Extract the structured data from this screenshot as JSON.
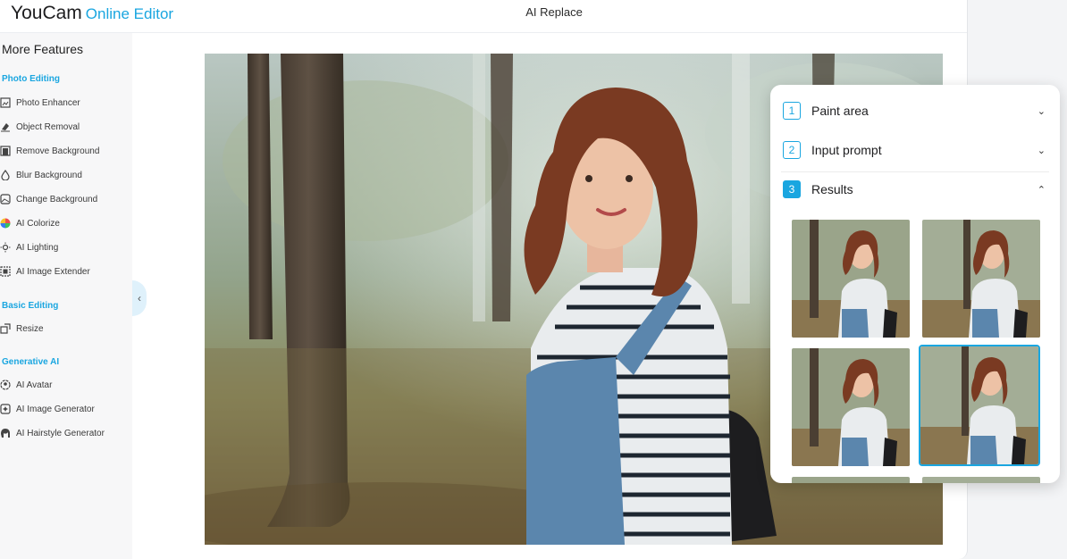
{
  "header": {
    "brand": "YouCam",
    "brand_tag": "Online Editor",
    "title": "AI Replace"
  },
  "sidebar": {
    "heading": "More Features",
    "sections": [
      {
        "title": "Photo Editing"
      },
      {
        "title": "Basic Editing"
      },
      {
        "title": "Generative AI"
      }
    ],
    "photo_editing": [
      {
        "label": "Photo Enhancer",
        "icon": "enhance-icon"
      },
      {
        "label": "Object Removal",
        "icon": "eraser-icon"
      },
      {
        "label": "Remove Background",
        "icon": "remove-bg-icon"
      },
      {
        "label": "Blur Background",
        "icon": "blur-icon"
      },
      {
        "label": "Change Background",
        "icon": "change-bg-icon"
      },
      {
        "label": "AI Colorize",
        "icon": "colorize-icon"
      },
      {
        "label": "AI Lighting",
        "icon": "lighting-icon"
      },
      {
        "label": "AI Image Extender",
        "icon": "extender-icon"
      }
    ],
    "basic_editing": [
      {
        "label": "Resize",
        "icon": "resize-icon"
      }
    ],
    "generative_ai": [
      {
        "label": "AI Avatar",
        "icon": "avatar-icon"
      },
      {
        "label": "AI Image Generator",
        "icon": "image-generator-icon"
      },
      {
        "label": "AI Hairstyle Generator",
        "icon": "hairstyle-icon"
      }
    ],
    "collapse_glyph": "‹"
  },
  "panel": {
    "steps": [
      {
        "number": "1",
        "label": "Paint area",
        "chevron": "⌄"
      },
      {
        "number": "2",
        "label": "Input prompt",
        "chevron": "⌄"
      },
      {
        "number": "3",
        "label": "Results",
        "chevron": "⌃"
      }
    ],
    "results": [
      {
        "id": 1,
        "selected": false
      },
      {
        "id": 2,
        "selected": false
      },
      {
        "id": 3,
        "selected": false
      },
      {
        "id": 4,
        "selected": true
      }
    ]
  },
  "colors": {
    "accent": "#1aa6e0",
    "sidebar_bg": "#f7f7f8",
    "collapse_bg": "#dff1fb"
  }
}
